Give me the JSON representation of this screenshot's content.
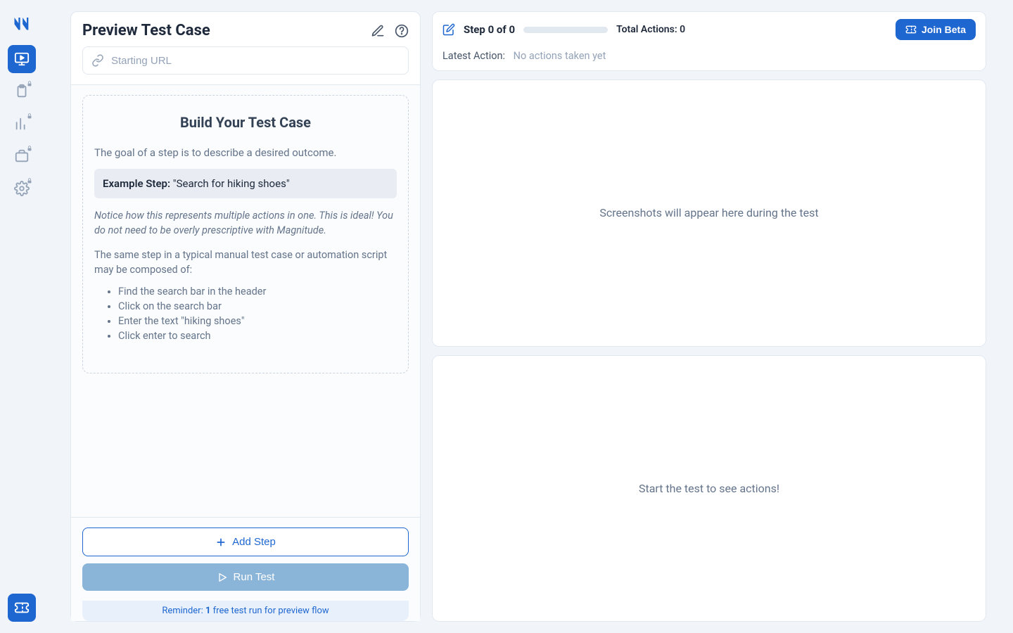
{
  "sidebar": {
    "items": [
      {
        "name": "monitor",
        "active": true
      },
      {
        "name": "clipboard",
        "locked": true
      },
      {
        "name": "chart",
        "locked": true
      },
      {
        "name": "briefcase",
        "locked": true
      },
      {
        "name": "settings",
        "locked": true
      }
    ],
    "bottom_item": {
      "name": "ticket"
    }
  },
  "left": {
    "title": "Preview Test Case",
    "url_placeholder": "Starting URL",
    "dashed": {
      "title": "Build Your Test Case",
      "subtitle": "The goal of a step is to describe a desired outcome.",
      "example_label": "Example Step:",
      "example_value": "\"Search for hiking shoes\"",
      "notice": "Notice how this represents multiple actions in one. This is ideal! You do not need to be overly prescriptive with Magnitude.",
      "same_step_intro": "The same step in a typical manual test case or automation script may be composed of:",
      "bullets": [
        "Find the search bar in the header",
        "Click on the search bar",
        "Enter the text \"hiking shoes\"",
        "Click enter to search"
      ]
    },
    "add_step_label": "Add Step",
    "run_test_label": "Run Test",
    "reminder_prefix": "Reminder: ",
    "reminder_count": "1",
    "reminder_suffix": " free test run for preview flow"
  },
  "status": {
    "step_text": "Step 0 of 0",
    "total_actions_label": "Total Actions: ",
    "total_actions_value": "0",
    "join_label": "Join Beta",
    "latest_label": "Latest Action:",
    "latest_value": "No actions taken yet"
  },
  "placeholders": {
    "screenshots": "Screenshots will appear here during the test",
    "actions": "Start the test to see actions!"
  }
}
